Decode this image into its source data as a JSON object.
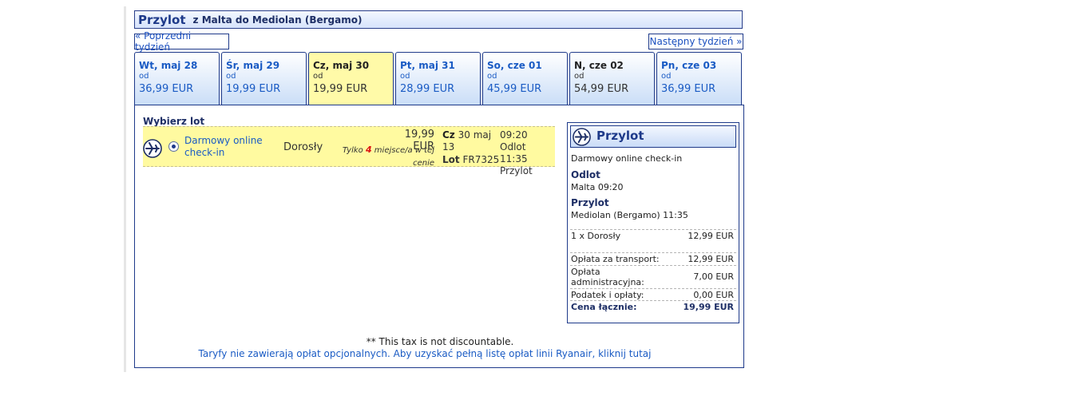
{
  "header": {
    "title": "Przylot",
    "subtitle": "z Malta do Mediolan (Bergamo)"
  },
  "nav": {
    "prev_label": "« Poprzedni tydzień",
    "next_label": "Następny tydzień »"
  },
  "tabs": [
    {
      "day": "Wt, maj 28",
      "od": "od",
      "price": "36,99 EUR"
    },
    {
      "day": "Śr, maj 29",
      "od": "od",
      "price": "19,99 EUR"
    },
    {
      "day": "Cz, maj 30",
      "od": "od",
      "price": "19,99 EUR"
    },
    {
      "day": "Pt, maj 31",
      "od": "od",
      "price": "28,99 EUR"
    },
    {
      "day": "So, cze 01",
      "od": "od",
      "price": "45,99 EUR"
    },
    {
      "day": "N, cze 02",
      "od": "od",
      "price": "54,99 EUR"
    },
    {
      "day": "Pn, cze 03",
      "od": "od",
      "price": "36,99 EUR"
    }
  ],
  "main": {
    "select_title": "Wybierz lot",
    "flight": {
      "fare_name": "Darmowy online check-in",
      "pax_type": "Dorosły",
      "price": "19,99 EUR",
      "seats_prefix": "Tylko",
      "seats_count": "4",
      "seats_suffix": "miejsce/a w tej cenie",
      "day_short": "Cz",
      "date_rest": "30 maj 13",
      "lot_label": "Lot",
      "flight_no": "FR7325",
      "depart_time": "09:20",
      "depart_label": "Odlot",
      "arrive_time": "11:35",
      "arrive_label": "Przylot"
    },
    "tax_note": "** This tax is not discountable.",
    "fees_link": "Taryfy nie zawierają opłat opcjonalnych. Aby uzyskać pełną listę opłat linii Ryanair, kliknij tutaj"
  },
  "summary": {
    "title": "Przylot",
    "fare_name": "Darmowy online check-in",
    "depart_label": "Odlot",
    "depart_value": "Malta 09:20",
    "arrive_label": "Przylot",
    "arrive_value": "Mediolan (Bergamo) 11:35",
    "lines": [
      {
        "label": "1 x Dorosły",
        "value": "12,99 EUR"
      },
      {
        "label": "Opłata za transport:",
        "value": "12,99 EUR"
      },
      {
        "label": "Opłata administracyjna:",
        "value": "7,00 EUR"
      },
      {
        "label": "Podatek i opłaty:",
        "value": "0,00 EUR"
      }
    ],
    "total_label": "Cena łącznie:",
    "total_value": "19,99 EUR"
  },
  "colors": {
    "brand_blue": "#1e3a8a",
    "link_blue": "#1a5bc4",
    "selected_yellow": "#fffaa8",
    "alert_red": "#dd1111"
  },
  "selected_tab": 2
}
